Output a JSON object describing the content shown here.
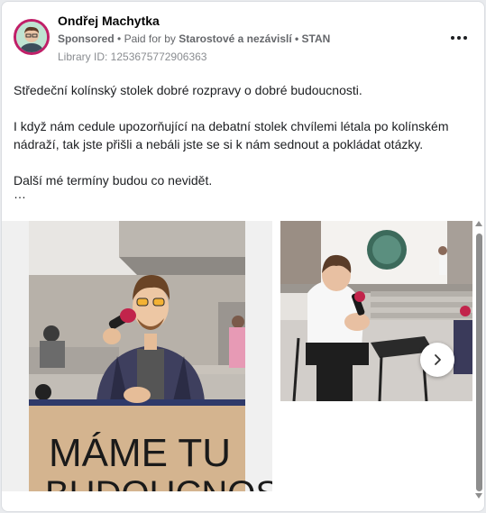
{
  "post": {
    "author_name": "Ondřej Machytka",
    "sponsored_label": "Sponsored",
    "separator": "•",
    "paid_for_prefix": "Paid for by",
    "paid_for_by": "Starostové a nezávislí • STAN",
    "library_id": "Library ID: 1253675772906363",
    "text_paragraphs": [
      "Středeční kolínský stolek dobré rozpravy o dobré budoucnosti.",
      "I když nám cedule upozorňující na debatní stolek chvílemi létala po kolínském nádraží, tak jste přišli a nebáli jste se si k nám sednout a pokládat otázky.",
      "Další mé termíny budou co nevidět."
    ],
    "ellipsis": "…"
  },
  "carousel": {
    "sign_text_line1": "MÁME TU",
    "sign_text_line2": "BUDOUCNOSTI"
  },
  "icons": {
    "more": "more-options-icon",
    "next": "chevron-right-icon"
  },
  "colors": {
    "avatar_ring": "#c01f68",
    "sponsored_text": "#65676b",
    "author_text": "#050505",
    "sign_background": "#d4b48f"
  }
}
